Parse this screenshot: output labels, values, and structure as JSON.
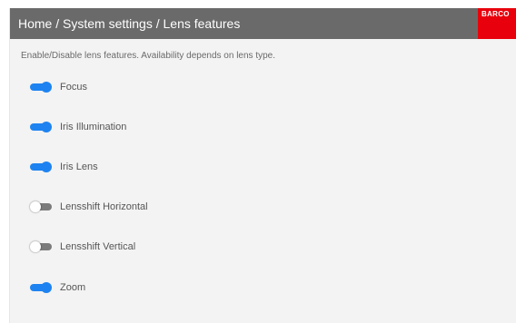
{
  "header": {
    "breadcrumb": "Home / System settings / Lens features",
    "logo_text": "BARCO"
  },
  "description": "Enable/Disable lens features. Availability depends on lens type.",
  "features": [
    {
      "label": "Focus",
      "enabled": true
    },
    {
      "label": "Iris Illumination",
      "enabled": true
    },
    {
      "label": "Iris Lens",
      "enabled": true
    },
    {
      "label": "Lensshift Horizontal",
      "enabled": false
    },
    {
      "label": "Lensshift Vertical",
      "enabled": false
    },
    {
      "label": "Zoom",
      "enabled": true
    }
  ],
  "colors": {
    "header_bg": "#6a6a6a",
    "logo_bg": "#e8000c",
    "toggle_on": "#1e83f0",
    "toggle_off": "#7b7b7b",
    "panel_bg": "#f3f3f3"
  }
}
